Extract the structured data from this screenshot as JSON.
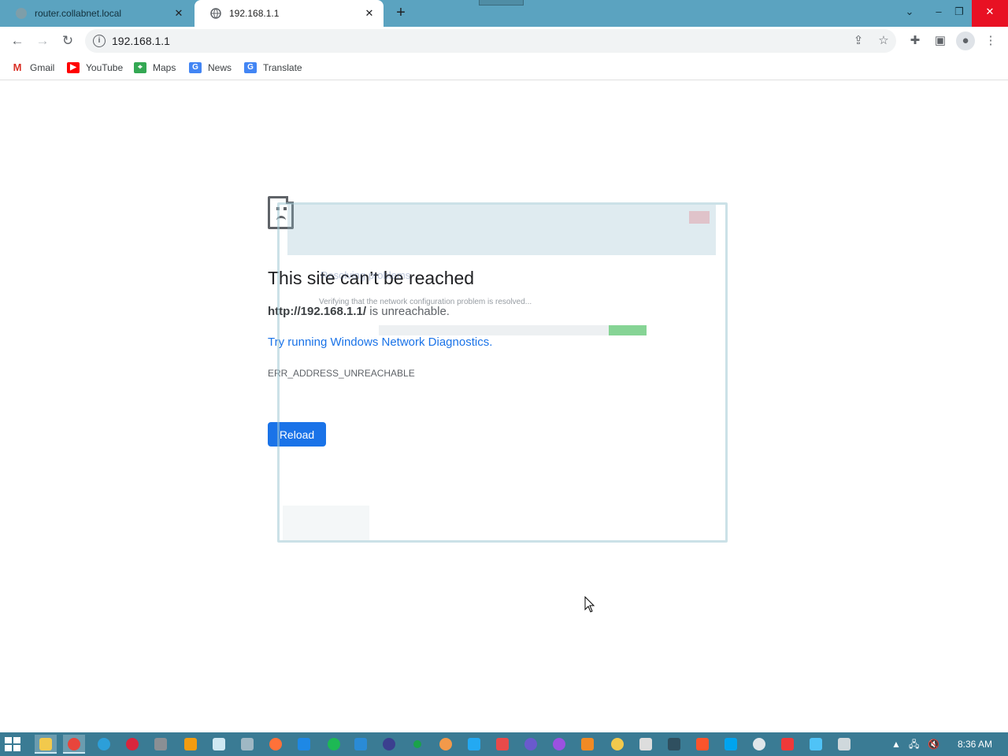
{
  "tabs": [
    {
      "title": "router.collabnet.local",
      "active": false
    },
    {
      "title": "192.168.1.1",
      "active": true
    }
  ],
  "toolbar": {
    "url": "192.168.1.1"
  },
  "bookmarks": [
    {
      "label": "Gmail",
      "icon": "gmail-icon",
      "color": "#d93025"
    },
    {
      "label": "YouTube",
      "icon": "youtube-icon",
      "color": "#ff0000"
    },
    {
      "label": "Maps",
      "icon": "maps-icon",
      "color": "#34a853"
    },
    {
      "label": "News",
      "icon": "news-icon",
      "color": "#4285f4"
    },
    {
      "label": "Translate",
      "icon": "translate-icon",
      "color": "#4285f4"
    }
  ],
  "error": {
    "title": "This site can’t be reached",
    "url_strong": "http://192.168.1.1/",
    "url_rest": " is unreachable.",
    "diagnostics_link": "Try running Windows Network Diagnostics.",
    "code": "ERR_ADDRESS_UNREACHABLE",
    "reload_label": "Reload"
  },
  "diagnostics_overlay": {
    "heading": "Resolving problems",
    "status": "Verifying that the network configuration problem is resolved...",
    "progress": 0.14
  },
  "taskbar": {
    "clock": "8:36 AM"
  },
  "colors": {
    "tabstrip": "#5ba3c0",
    "taskbar": "#3a7b94",
    "accent": "#1a73e8"
  }
}
